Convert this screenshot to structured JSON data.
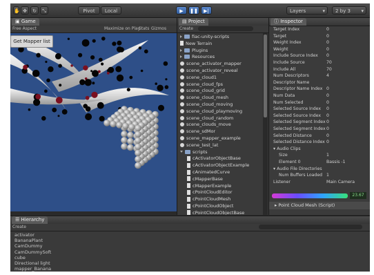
{
  "toolbar": {
    "pivot_label": "Pivot",
    "local_label": "Local",
    "layers_label": "Layers",
    "layout_label": "2 by 3"
  },
  "game": {
    "tab_label": "Game",
    "aspect_label": "Free Aspect",
    "options": [
      "Maximize on Play",
      "Stats",
      "Gizmos"
    ],
    "button_label": "Get Mapper list"
  },
  "project": {
    "tab_label": "Project",
    "create_label": "Create",
    "items": [
      {
        "label": "fiac-unity-scripts",
        "kind": "folder",
        "depth": 0
      },
      {
        "label": "New Terrain",
        "kind": "file",
        "depth": 0
      },
      {
        "label": "Plugins",
        "kind": "folder",
        "depth": 0
      },
      {
        "label": "Resources",
        "kind": "folder",
        "depth": 0
      },
      {
        "label": "scene_activator_mapper",
        "kind": "scene",
        "depth": 0
      },
      {
        "label": "scene_activator_reveal",
        "kind": "scene",
        "depth": 0
      },
      {
        "label": "scene_cloud1",
        "kind": "scene",
        "depth": 0
      },
      {
        "label": "scene_cloud_fps",
        "kind": "scene",
        "depth": 0
      },
      {
        "label": "scene_cloud_grid",
        "kind": "scene",
        "depth": 0
      },
      {
        "label": "scene_cloud_mesh",
        "kind": "scene",
        "depth": 0
      },
      {
        "label": "scene_cloud_moving",
        "kind": "scene",
        "depth": 0
      },
      {
        "label": "scene_cloud_playmoving",
        "kind": "scene",
        "depth": 0
      },
      {
        "label": "scene_cloud_random",
        "kind": "scene",
        "depth": 0
      },
      {
        "label": "scene_clouds_move",
        "kind": "scene",
        "depth": 0
      },
      {
        "label": "scene_sdMor",
        "kind": "scene",
        "depth": 0
      },
      {
        "label": "scene_mapper_example",
        "kind": "scene",
        "depth": 0
      },
      {
        "label": "scene_test_lat",
        "kind": "scene",
        "depth": 0
      },
      {
        "label": "scripts",
        "kind": "folder-open",
        "depth": 0
      },
      {
        "label": "cActivatorObjectBase",
        "kind": "file",
        "depth": 1
      },
      {
        "label": "cActivatorObjectExample",
        "kind": "file",
        "depth": 1
      },
      {
        "label": "cAnimatedCurve",
        "kind": "file",
        "depth": 1
      },
      {
        "label": "cMapperBase",
        "kind": "file",
        "depth": 1
      },
      {
        "label": "cMapperExample",
        "kind": "file",
        "depth": 1
      },
      {
        "label": "cPointCloudEditor",
        "kind": "file",
        "depth": 1
      },
      {
        "label": "cPointCloudMesh",
        "kind": "file",
        "depth": 1
      },
      {
        "label": "cPointCloudObject",
        "kind": "file",
        "depth": 1
      },
      {
        "label": "cPointCloudObjectBase",
        "kind": "file",
        "depth": 1
      }
    ]
  },
  "inspector": {
    "tab_label": "Inspector",
    "rows": [
      {
        "label": "Target Index",
        "value": "0"
      },
      {
        "label": "Target",
        "value": "0"
      },
      {
        "label": "Weight Index",
        "value": "0"
      },
      {
        "label": "Weight",
        "value": "0"
      },
      {
        "label": "Include Source Index",
        "value": "0"
      },
      {
        "label": "Include Source",
        "value": "70"
      },
      {
        "label": "Include All",
        "value": "70"
      },
      {
        "label": "Num Descriptors",
        "value": "4"
      },
      {
        "label": "Descriptor Name",
        "value": ""
      },
      {
        "label": "Descriptor Name Index",
        "value": "0"
      },
      {
        "label": "Num Data",
        "value": "0"
      },
      {
        "label": "Num Selected",
        "value": "0"
      },
      {
        "label": "Selected Source Index",
        "value": "0"
      },
      {
        "label": "Selected Source Index",
        "value": "0"
      },
      {
        "label": "Selected Segment Index",
        "value": "0"
      },
      {
        "label": "Selected Segment Index",
        "value": "0"
      },
      {
        "label": "Selected Distance",
        "value": "0"
      },
      {
        "label": "Selected Distance Index",
        "value": "0"
      },
      {
        "label": "Audio Clips",
        "value": ""
      },
      {
        "label": "Size",
        "value": "1"
      },
      {
        "label": "Element 0",
        "value": "Bassis -1"
      },
      {
        "label": "Audio File Directories",
        "value": ""
      },
      {
        "label": "Num Buffers Loaded",
        "value": "1"
      },
      {
        "label": "Listener",
        "value": "Main Camera"
      }
    ],
    "slider_value": "23.67",
    "footer_label": "Point Cloud Mesh (Script)"
  },
  "hierarchy": {
    "tab_label": "Hierarchy",
    "create_label": "Create",
    "items": [
      "activator",
      "BananaPlant",
      "CamDummy",
      "CamDummySoft",
      "cube",
      "Directional light",
      "mapper_Banana"
    ]
  },
  "colors": {
    "scene_background": "#2e4f88",
    "panel_background": "#3a3a3a",
    "accent_blue": "#3d6fb8"
  }
}
